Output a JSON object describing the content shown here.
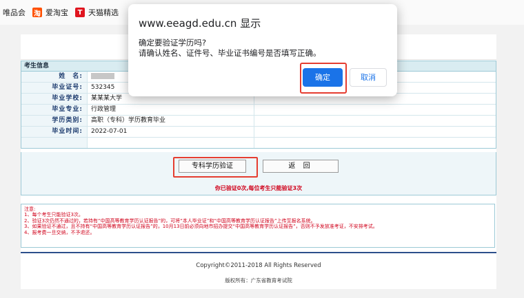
{
  "bookmarks": [
    {
      "label": "唯品会",
      "icon": "",
      "color": ""
    },
    {
      "label": "爱淘宝",
      "icon": "淘",
      "color": "#ff5000"
    },
    {
      "label": "天猫精选",
      "icon": "T",
      "color": "#e0151f"
    }
  ],
  "info": {
    "header": "考生信息",
    "rows": [
      {
        "label": "姓　名:",
        "value": ""
      },
      {
        "label": "毕业证号:",
        "value": "532345"
      },
      {
        "label": "毕业学校:",
        "value": "某某某大学"
      },
      {
        "label": "毕业专业:",
        "value": "行政管理"
      },
      {
        "label": "学历类别:",
        "value": "高职（专科）学历教育毕业"
      },
      {
        "label": "毕业时间:",
        "value": "2022-07-01"
      }
    ]
  },
  "actions": {
    "verify_label": "专科学历验证",
    "back_label": "返 回",
    "warning": "你已验证0次,每位考生只能验证3次"
  },
  "notes": [
    "注意:",
    "1、每个考生只能验证3次。",
    "2、验证3次仍然不通过的，若持有“中国高等教育学历认证报告”的，可将“本人毕业证”和“中国高等教育学历认证报告”上传至报名系统。",
    "3、如果验证不通过，且不持有“中国高等教育学历认证报告”的，10月13日前必须向地市招办提交“中国高等教育学历认证报告”，否则不予发放准考证，不安排考试。",
    "4、报考费一旦交纳，不予退还。"
  ],
  "footer": {
    "copyright": "Copyright©2011-2018 All Rights Reserved",
    "owner": "版权所有：广东省教育考试院"
  },
  "dialog": {
    "title": "www.eeagd.edu.cn 显示",
    "message_line1": "确定要验证学历吗?",
    "message_line2": "请确认姓名、证件号、毕业证书编号是否填写正确。",
    "ok_label": "确定",
    "cancel_label": "取消"
  },
  "colors": {
    "highlight": "#e53c2f",
    "primary_button": "#1a73e8",
    "table_border": "#9cc9d6"
  }
}
